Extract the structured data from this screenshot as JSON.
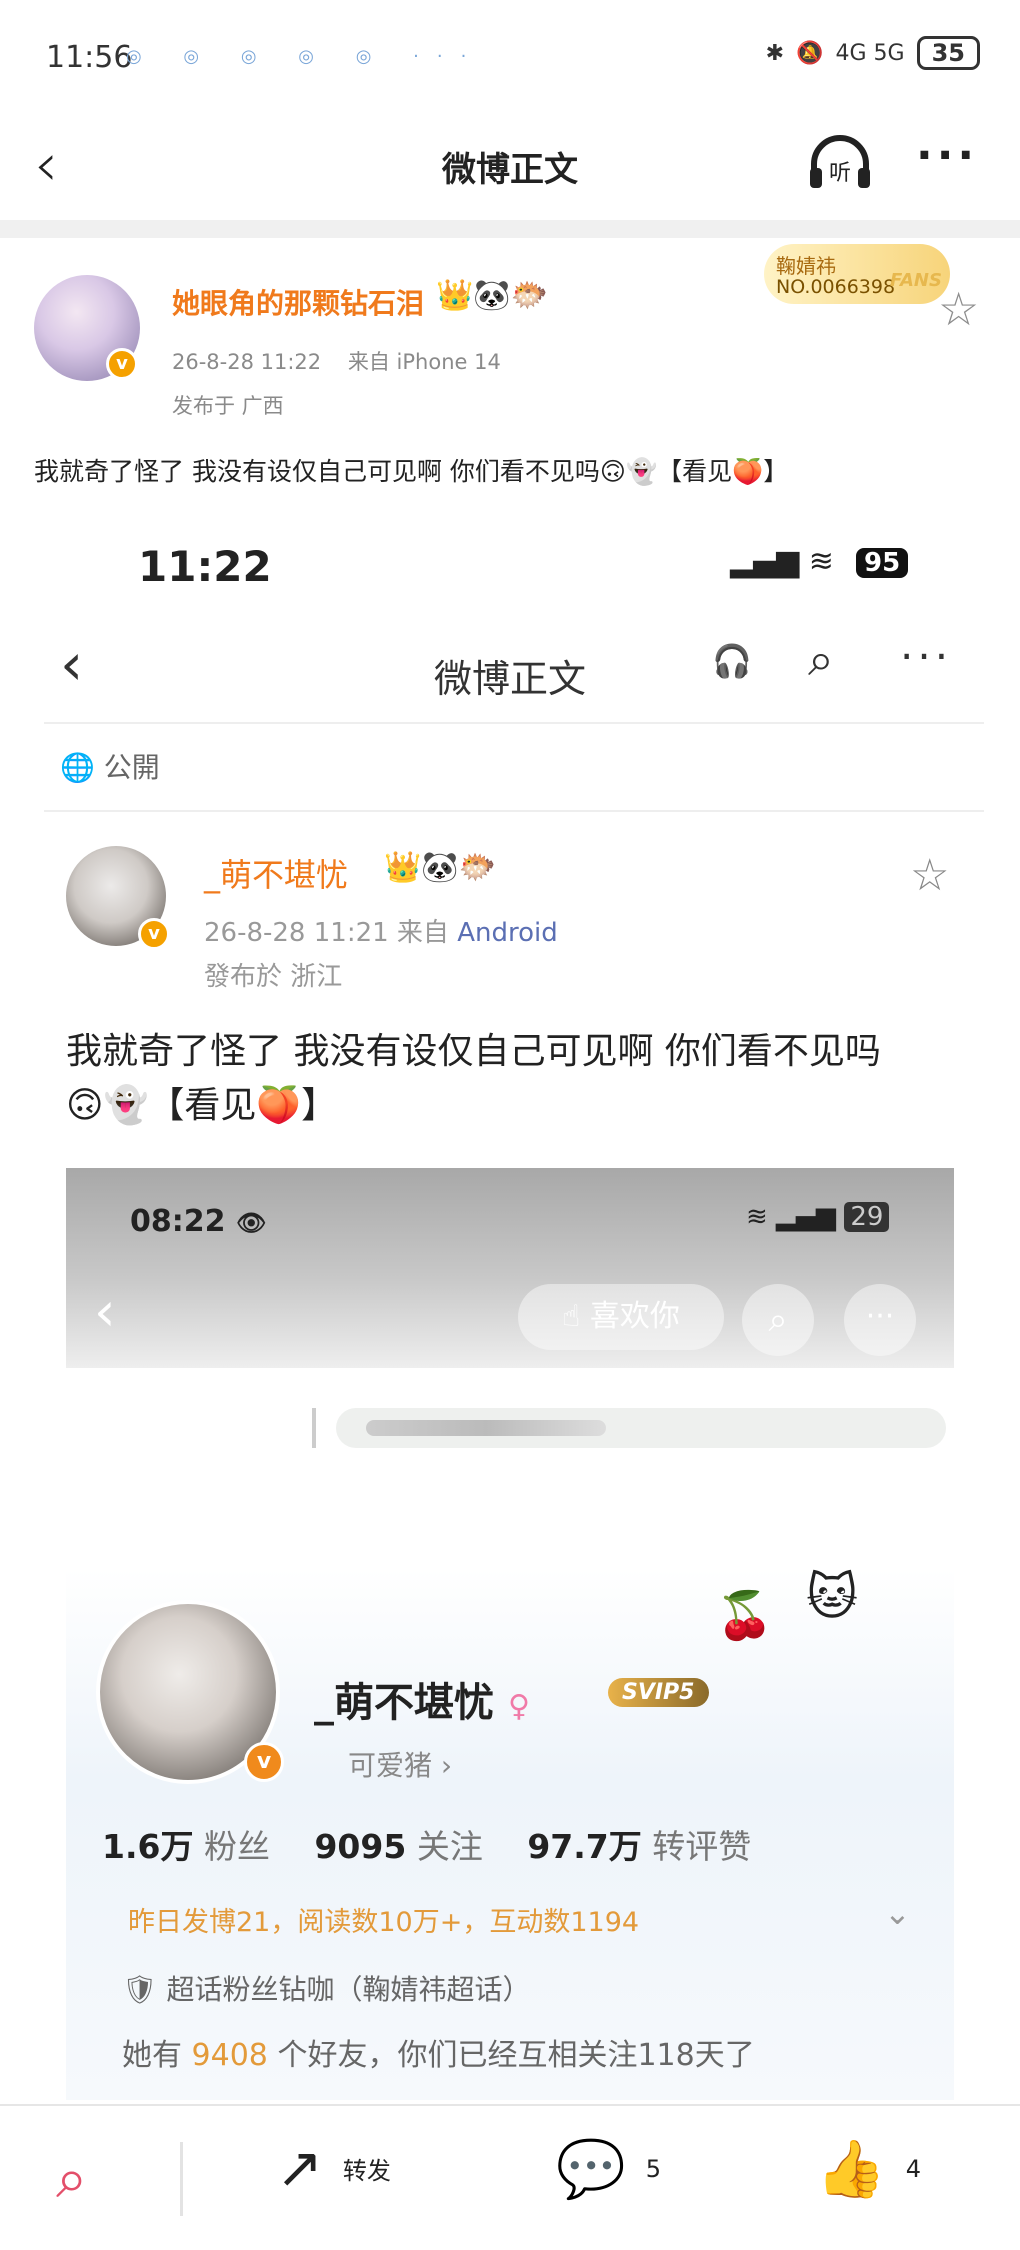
{
  "status_bar": {
    "time": "11:56",
    "notif_icons": "◎ ◎ ◎ ◎ ◎ ···",
    "network": "4G 5G",
    "battery": "35"
  },
  "nav": {
    "title": "微博正文",
    "listen_label": "听"
  },
  "post": {
    "author": "她眼角的那颗钻石泪",
    "author_emoji": "👑🐼🐡",
    "time": "26-8-28 11:22",
    "source": "来自 iPhone 14",
    "location": "发布于 广西",
    "fan_card": {
      "name": "鞠婧祎",
      "number": "NO.0066398",
      "tag": "FANS"
    },
    "text": "我就奇了怪了 我没有设仅自己可见啊 你们看不见吗🙃👻【看见🍑】"
  },
  "embedded": {
    "status_time": "11:22",
    "battery": "95",
    "nav_title": "微博正文",
    "visibility": "公開",
    "author": "_萌不堪忧",
    "author_emoji": "👑🐼🐡",
    "meta_time": "26-8-28 11:21 来自",
    "meta_source": "Android",
    "location": "發布於 浙江",
    "text_line1": "我就奇了怪了 我没有设仅自己可见啊 你们看不见吗",
    "text_line2": "🙃👻【看见🍑】",
    "inner": {
      "status_time": "08:22",
      "battery": "29",
      "like_label": "喜欢你",
      "profile_name": "_萌不堪忧",
      "svip": "SVIP5",
      "tag": "可爱猪 ›",
      "fans_count": "1.6万",
      "fans_label": "粉丝",
      "following_count": "9095",
      "following_label": "关注",
      "interactions_count": "97.7万",
      "interactions_label": "转评赞",
      "activity": "昨日发博21，阅读数10万+，互动数1194",
      "super_topic": "超话粉丝钻咖（鞠婧祎超话）",
      "friends_prefix": "她有",
      "friends_count": "9408",
      "friends_suffix": "个好友，你们已经互相关注118天了"
    }
  },
  "bottom_bar": {
    "repost_label": "转发",
    "comment_count": "5",
    "like_count": "4"
  },
  "colors": {
    "accent_orange": "#f07a1c",
    "vip_gold": "#f5a100",
    "ai_red": "#e34f6a"
  }
}
